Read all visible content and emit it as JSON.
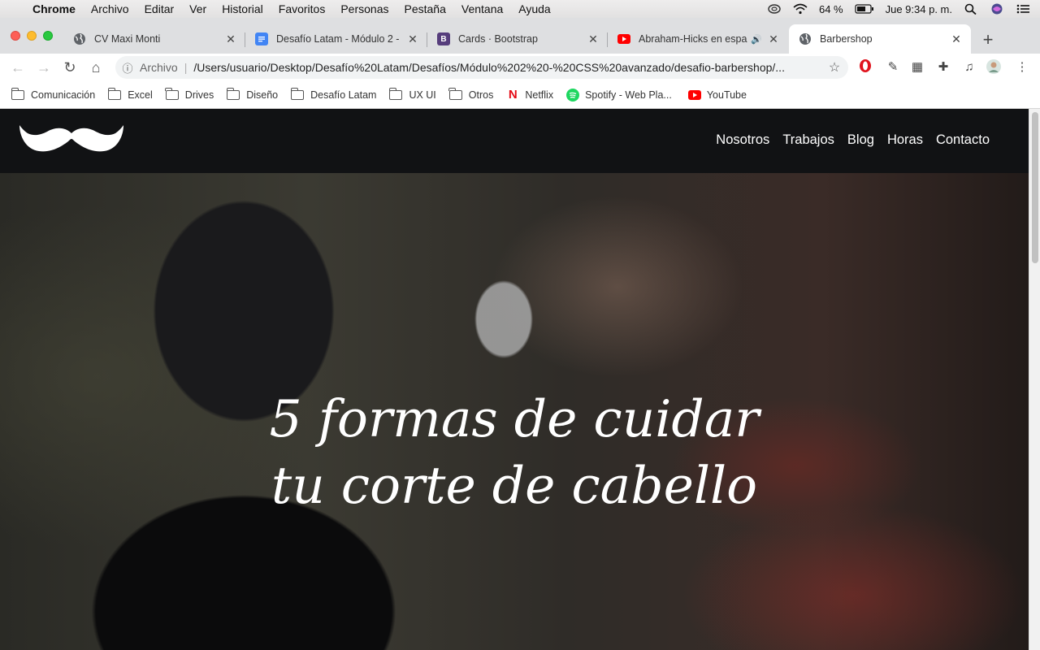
{
  "menubar": {
    "app": "Chrome",
    "items": [
      "Archivo",
      "Editar",
      "Ver",
      "Historial",
      "Favoritos",
      "Personas",
      "Pestaña",
      "Ventana",
      "Ayuda"
    ],
    "battery": "64 %",
    "clock": "Jue 9:34 p. m."
  },
  "tabs": [
    {
      "title": "CV Maxi Monti",
      "icon": "globe-icon",
      "active": false
    },
    {
      "title": "Desafío Latam - Módulo 2 -",
      "icon": "google-docs-icon",
      "active": false
    },
    {
      "title": "Cards · Bootstrap",
      "icon": "bootstrap-icon",
      "active": false
    },
    {
      "title": "Abraham-Hicks en espa",
      "icon": "youtube-icon",
      "active": false,
      "audio": true
    },
    {
      "title": "Barbershop",
      "icon": "globe-icon",
      "active": true
    }
  ],
  "omnibox": {
    "scheme": "Archivo",
    "url": "/Users/usuario/Desktop/Desafío%20Latam/Desafíos/Módulo%202%20-%20CSS%20avanzado/desafio-barbershop/..."
  },
  "bookmarks": [
    {
      "label": "Comunicación",
      "icon": "folder-icon"
    },
    {
      "label": "Excel",
      "icon": "folder-icon"
    },
    {
      "label": "Drives",
      "icon": "folder-icon"
    },
    {
      "label": "Diseño",
      "icon": "folder-icon"
    },
    {
      "label": "Desafío Latam",
      "icon": "folder-icon"
    },
    {
      "label": "UX UI",
      "icon": "folder-icon"
    },
    {
      "label": "Otros",
      "icon": "folder-icon"
    },
    {
      "label": "Netflix",
      "icon": "netflix-icon"
    },
    {
      "label": "Spotify - Web Pla...",
      "icon": "spotify-icon"
    },
    {
      "label": "YouTube",
      "icon": "youtube-icon"
    }
  ],
  "site": {
    "nav": [
      "Nosotros",
      "Trabajos",
      "Blog",
      "Horas",
      "Contacto"
    ],
    "hero_line1": "5 formas de cuidar",
    "hero_line2": "tu corte de cabello"
  },
  "colors": {
    "nav_bg": "#111214",
    "hero_text": "#ffffff"
  }
}
